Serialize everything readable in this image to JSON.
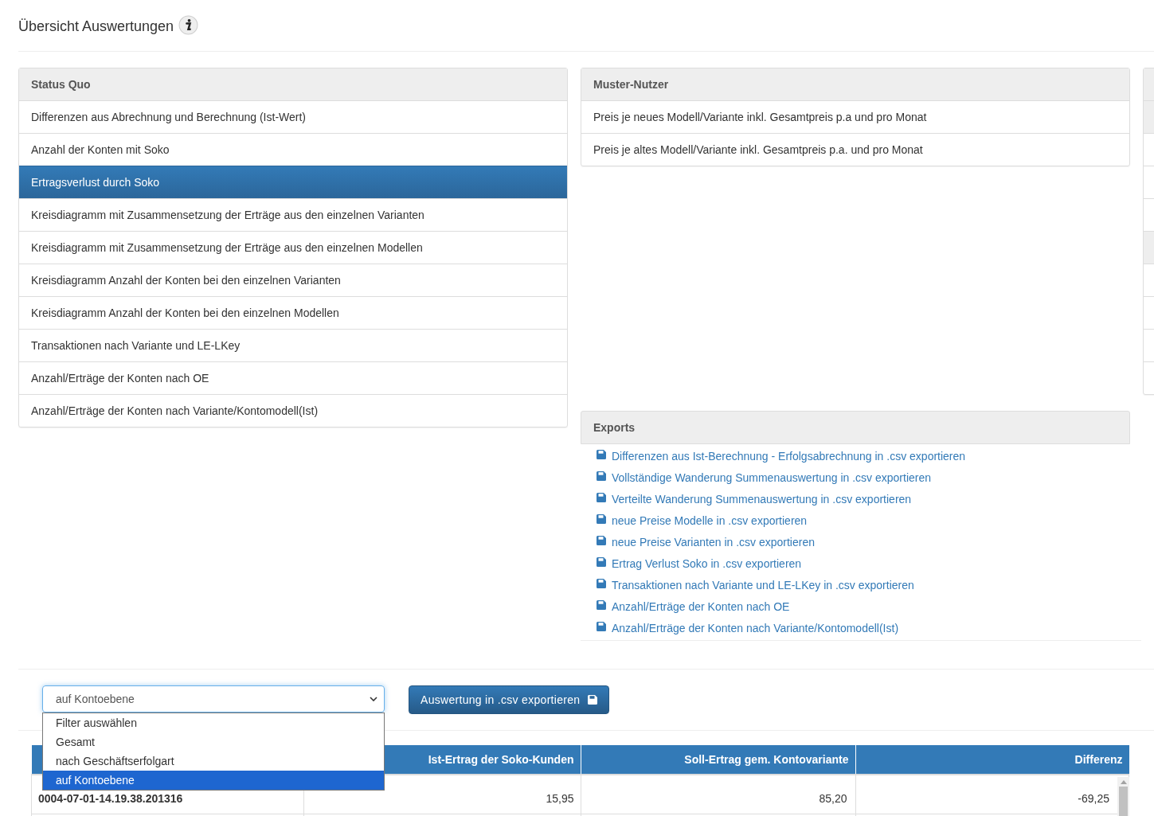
{
  "page_title": "Übersicht Auswertungen",
  "panels": [
    {
      "heading": "Status Quo",
      "items": [
        {
          "label": "Differenzen aus Abrechnung und Berechnung (Ist-Wert)",
          "selected": false
        },
        {
          "label": "Anzahl der Konten mit Soko",
          "selected": false
        },
        {
          "label": "Ertragsverlust durch Soko",
          "selected": true
        },
        {
          "label": "Kreisdiagramm mit Zusammensetzung der Erträge aus den einzelnen Varianten",
          "selected": false
        },
        {
          "label": "Kreisdiagramm mit Zusammensetzung der Erträge aus den einzelnen Modellen",
          "selected": false
        },
        {
          "label": "Kreisdiagramm Anzahl der Konten bei den einzelnen Varianten",
          "selected": false
        },
        {
          "label": "Kreisdiagramm Anzahl der Konten bei den einzelnen Modellen",
          "selected": false
        },
        {
          "label": "Transaktionen nach Variante und LE-LKey",
          "selected": false
        },
        {
          "label": "Anzahl/Erträge der Konten nach OE",
          "selected": false
        },
        {
          "label": "Anzahl/Erträge der Konten nach Variante/Kontomodell(Ist)",
          "selected": false
        }
      ]
    },
    {
      "heading": "Muster-Nutzer",
      "items": [
        {
          "label": "Preis je neues Modell/Variante inkl. Gesamtpreis p.a und pro Monat",
          "selected": false
        },
        {
          "label": "Preis je altes Modell/Variante inkl. Gesamtpreis p.a. und pro Monat",
          "selected": false
        }
      ]
    }
  ],
  "panel_3_rows": [
    {
      "kind": "heading"
    },
    {
      "kind": "heading"
    },
    {
      "kind": "item"
    },
    {
      "kind": "item"
    },
    {
      "kind": "item"
    },
    {
      "kind": "heading"
    },
    {
      "kind": "item"
    },
    {
      "kind": "item"
    },
    {
      "kind": "item"
    },
    {
      "kind": "item"
    }
  ],
  "exports": {
    "heading": "Exports",
    "links": [
      "Differenzen aus Ist-Berechnung - Erfolgsabrechnung in .csv exportieren",
      "Vollständige Wanderung Summenauswertung in .csv exportieren",
      "Verteilte Wanderung Summenauswertung in .csv exportieren",
      "neue Preise Modelle in .csv exportieren",
      "neue Preise Varianten in .csv exportieren",
      "Ertrag Verlust Soko in .csv exportieren",
      "Transaktionen nach Variante und LE-LKey in .csv exportieren",
      "Anzahl/Erträge der Konten nach OE",
      "Anzahl/Erträge der Konten nach Variante/Kontomodell(Ist)"
    ]
  },
  "filter": {
    "value": "auf Kontoebene",
    "expanded": true,
    "options": [
      {
        "label": "Filter auswählen",
        "selected": false
      },
      {
        "label": "Gesamt",
        "selected": false
      },
      {
        "label": "nach Geschäftserfolgart",
        "selected": false
      },
      {
        "label": "auf Kontoebene",
        "selected": true
      }
    ]
  },
  "export_button": "Auswertung in .csv exportieren",
  "table": {
    "columns": [
      {},
      {
        "label": "Ist-Ertrag der Soko-Kunden"
      },
      {
        "label": "Soll-Ertrag gem. Kontovariante"
      },
      {
        "label": "Differenz"
      }
    ],
    "rows": [
      [
        "0004-07-01-14.19.38.201316",
        "15,95",
        "85,20",
        "-69,25"
      ],
      [
        "",
        "",
        "",
        ""
      ]
    ]
  }
}
